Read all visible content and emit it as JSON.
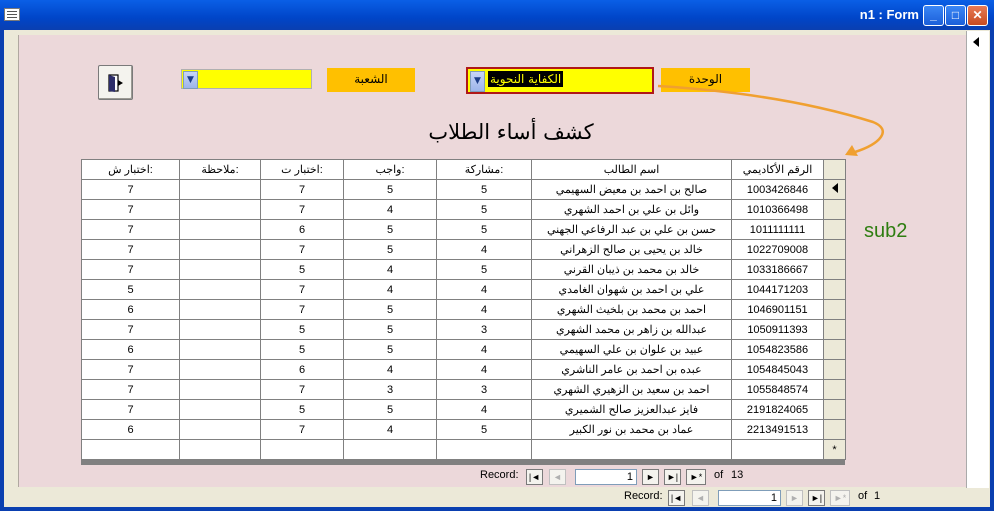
{
  "window": {
    "title": "n1 : Form",
    "min": "_",
    "max": "□",
    "close": "✕"
  },
  "form": {
    "heading": "كشف أساء الطلاب",
    "unit_label": "الوحدة",
    "unit_value": "الكفاية النحوية",
    "section_label": "الشعبة",
    "section_value": "",
    "subform_label": "sub2"
  },
  "grid": {
    "columns": [
      "الرقم الأكاديمي",
      "اسم الطالب",
      "مشاركة:",
      "واجب:",
      "اختبار ت:",
      "ملاحظة:",
      "اختبار ش:"
    ],
    "rows": [
      [
        "1003426846",
        "صالح بن احمد بن معيض السهيمي",
        "5",
        "5",
        "7",
        "",
        "7"
      ],
      [
        "1010366498",
        "وائل بن علي بن احمد الشهري",
        "5",
        "4",
        "7",
        "",
        "7"
      ],
      [
        "1011111111",
        "حسن بن علي بن عبد الرفاعي الجهني",
        "5",
        "5",
        "6",
        "",
        "7"
      ],
      [
        "1022709008",
        "خالد بن يحيى بن صالح الزهراني",
        "4",
        "5",
        "7",
        "",
        "7"
      ],
      [
        "1033186667",
        "خالد بن محمد بن ذيبان القرني",
        "5",
        "4",
        "5",
        "",
        "7"
      ],
      [
        "1044171203",
        "علي بن احمد بن شهوان الغامدي",
        "4",
        "4",
        "7",
        "",
        "5"
      ],
      [
        "1046901151",
        "احمد بن محمد بن بلخيث الشهري",
        "4",
        "5",
        "7",
        "",
        "6"
      ],
      [
        "1050911393",
        "عبدالله بن زاهر بن محمد الشهري",
        "3",
        "5",
        "5",
        "",
        "7"
      ],
      [
        "1054823586",
        "عبيد بن علوان بن علي السهيمي",
        "4",
        "5",
        "5",
        "",
        "6"
      ],
      [
        "1054845043",
        "عبده بن احمد بن عامر الناشري",
        "4",
        "4",
        "6",
        "",
        "7"
      ],
      [
        "1055848574",
        "احمد بن سعيد بن الزهيري الشهري",
        "3",
        "3",
        "7",
        "",
        "7"
      ],
      [
        "2191824065",
        "فايز عبدالعزيز صالح الشميري",
        "4",
        "5",
        "5",
        "",
        "7"
      ],
      [
        "2213491513",
        "عماد بن محمد بن نور الكبير",
        "5",
        "4",
        "7",
        "",
        "6"
      ]
    ],
    "new_row_marker": "*"
  },
  "sub_nav": {
    "label": "Record:",
    "current": "1",
    "of": "of",
    "total": "13"
  },
  "main_nav": {
    "label": "Record:",
    "current": "1",
    "of": "of",
    "total": "1"
  },
  "nav_icons": {
    "first": "|◄",
    "prev": "◄",
    "next": "►",
    "last": "►|",
    "new": "►*"
  },
  "colors": {
    "form_bg": "#ecd8da",
    "label_bg": "#ffc000",
    "combo_bg": "#ffff00",
    "title_bar": "#0a5fe6"
  }
}
